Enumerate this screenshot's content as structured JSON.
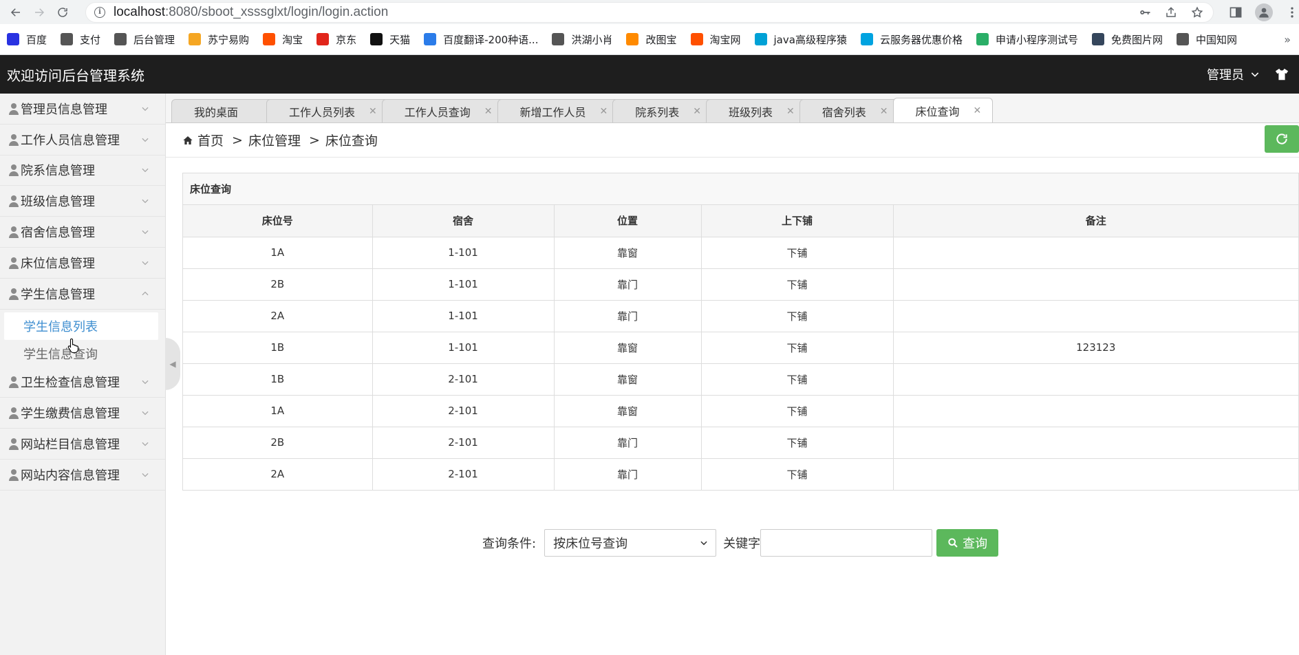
{
  "browser": {
    "url_host": "localhost",
    "url_rest": ":8080/sboot_xsssglxt/login/login.action"
  },
  "bookmarks": [
    {
      "label": "百度",
      "icon": "baidu-icon",
      "color": "#2932e1"
    },
    {
      "label": "支付",
      "icon": "globe-icon",
      "color": "#555555"
    },
    {
      "label": "后台管理",
      "icon": "globe-icon",
      "color": "#555555"
    },
    {
      "label": "苏宁易购",
      "icon": "suning-icon",
      "color": "#f5a623"
    },
    {
      "label": "淘宝",
      "icon": "taobao-icon",
      "color": "#ff5000"
    },
    {
      "label": "京东",
      "icon": "jd-icon",
      "color": "#e1251b"
    },
    {
      "label": "天猫",
      "icon": "tmall-icon",
      "color": "#111111"
    },
    {
      "label": "百度翻译-200种语...",
      "icon": "baidu-translate-icon",
      "color": "#2b7ce9"
    },
    {
      "label": "洪湖小肖",
      "icon": "bird-icon",
      "color": "#555555"
    },
    {
      "label": "改图宝",
      "icon": "gaitubao-icon",
      "color": "#ff8a00"
    },
    {
      "label": "淘宝网",
      "icon": "taobao-icon",
      "color": "#ff5000"
    },
    {
      "label": "java高级程序猿",
      "icon": "bilibili-icon",
      "color": "#00a1d6"
    },
    {
      "label": "云服务器优惠价格",
      "icon": "cloud-icon",
      "color": "#00a3e0"
    },
    {
      "label": "申请小程序测试号",
      "icon": "wechat-icon",
      "color": "#2aae67"
    },
    {
      "label": "免费图片网",
      "icon": "tumblr-icon",
      "color": "#35465c"
    },
    {
      "label": "中国知网",
      "icon": "cnki-icon",
      "color": "#555555"
    }
  ],
  "bookmarks_more": "»",
  "app": {
    "title": "欢迎访问后台管理系统",
    "user_label": "管理员"
  },
  "sidebar": {
    "items": [
      {
        "label": "管理员信息管理",
        "expanded": false
      },
      {
        "label": "工作人员信息管理",
        "expanded": false
      },
      {
        "label": "院系信息管理",
        "expanded": false
      },
      {
        "label": "班级信息管理",
        "expanded": false
      },
      {
        "label": "宿舍信息管理",
        "expanded": false
      },
      {
        "label": "床位信息管理",
        "expanded": false
      },
      {
        "label": "学生信息管理",
        "expanded": true
      },
      {
        "label": "卫生检查信息管理",
        "expanded": false
      },
      {
        "label": "学生缴费信息管理",
        "expanded": false
      },
      {
        "label": "网站栏目信息管理",
        "expanded": false
      },
      {
        "label": "网站内容信息管理",
        "expanded": false
      }
    ],
    "subitems": [
      "学生信息列表",
      "学生信息查询"
    ]
  },
  "tabs": [
    {
      "label": "我的桌面",
      "closable": false,
      "active": false
    },
    {
      "label": "工作人员列表",
      "closable": true,
      "active": false
    },
    {
      "label": "工作人员查询",
      "closable": true,
      "active": false
    },
    {
      "label": "新增工作人员",
      "closable": true,
      "active": false
    },
    {
      "label": "院系列表",
      "closable": true,
      "active": false
    },
    {
      "label": "班级列表",
      "closable": true,
      "active": false
    },
    {
      "label": "宿舍列表",
      "closable": true,
      "active": false
    },
    {
      "label": "床位查询",
      "closable": true,
      "active": true
    }
  ],
  "breadcrumb": {
    "home": "首页",
    "level1": "床位管理",
    "level2": "床位查询",
    "sep": ">"
  },
  "panel": {
    "title": "床位查询",
    "columns": [
      "床位号",
      "宿舍",
      "位置",
      "上下铺",
      "备注"
    ],
    "rows": [
      [
        "1A",
        "1-101",
        "靠窗",
        "下铺",
        ""
      ],
      [
        "2B",
        "1-101",
        "靠门",
        "下铺",
        ""
      ],
      [
        "2A",
        "1-101",
        "靠门",
        "下铺",
        ""
      ],
      [
        "1B",
        "1-101",
        "靠窗",
        "下铺",
        "123123"
      ],
      [
        "1B",
        "2-101",
        "靠窗",
        "下铺",
        ""
      ],
      [
        "1A",
        "2-101",
        "靠窗",
        "下铺",
        ""
      ],
      [
        "2B",
        "2-101",
        "靠门",
        "下铺",
        ""
      ],
      [
        "2A",
        "2-101",
        "靠门",
        "下铺",
        ""
      ]
    ]
  },
  "search": {
    "condition_label": "查询条件:",
    "select_value": "按床位号查询",
    "keyword_label": "关键字",
    "keyword_value": "",
    "button_label": "查询"
  },
  "colors": {
    "header_bg": "#1e1e1e",
    "accent_green": "#5cb85c",
    "active_link": "#3e8ed0"
  }
}
